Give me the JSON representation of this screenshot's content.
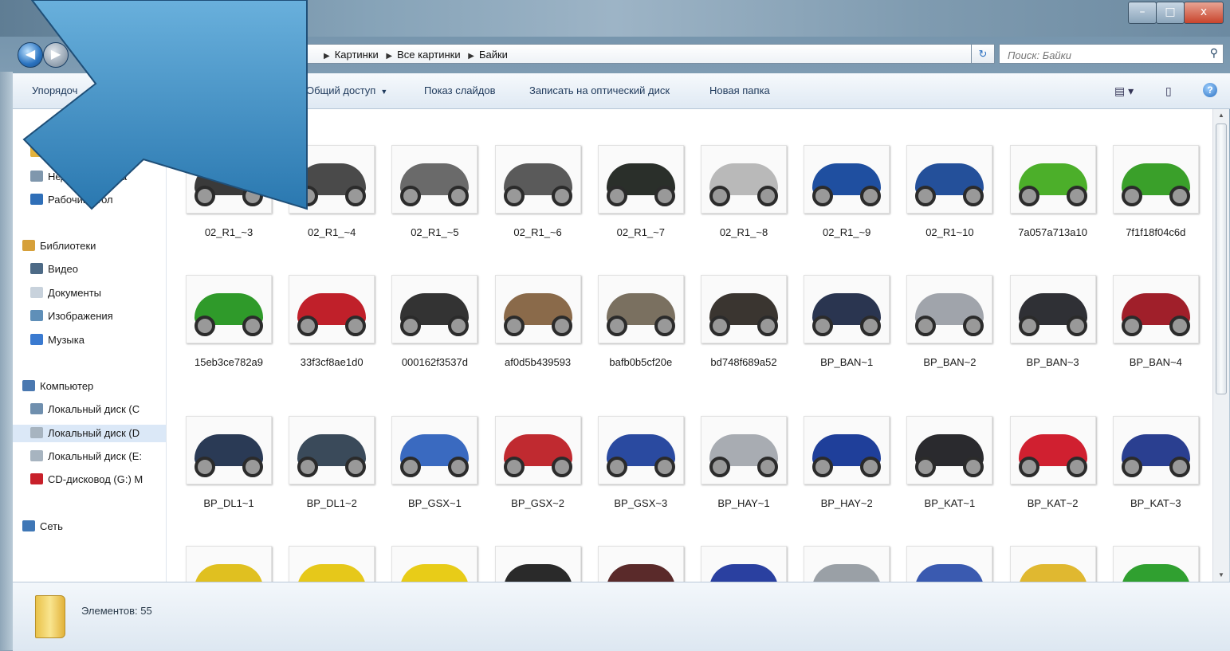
{
  "window": {
    "controls": {
      "minimize": "–",
      "maximize": "□",
      "close": "x"
    }
  },
  "navigation": {
    "back_icon": "back-arrow-icon",
    "forward_icon": "forward-arrow-icon",
    "breadcrumb": [
      "Картинки",
      "Все картинки",
      "Байки"
    ],
    "refresh_glyph": "↻",
    "search_placeholder": "Поиск: Байки"
  },
  "toolbar": {
    "organize": "Упорядоч",
    "share": "Общий доступ",
    "slideshow": "Показ слайдов",
    "burn": "Записать на оптический диск",
    "new_folder": "Новая папка"
  },
  "sidebar": {
    "items": [
      {
        "label": "Загр",
        "type": "item",
        "color": "#e3b23c"
      },
      {
        "label": "Недавние места",
        "type": "item",
        "color": "#7f97ad"
      },
      {
        "label": "Рабочий стол",
        "type": "item",
        "color": "#2f6fb8"
      },
      {
        "label": "Библиотеки",
        "type": "group",
        "color": "#d6a03a"
      },
      {
        "label": "Видео",
        "type": "item",
        "color": "#4d6a86"
      },
      {
        "label": "Документы",
        "type": "item",
        "color": "#c8d2dc"
      },
      {
        "label": "Изображения",
        "type": "item",
        "color": "#5f8fb8"
      },
      {
        "label": "Музыка",
        "type": "item",
        "color": "#3a7ad0"
      },
      {
        "label": "Компьютер",
        "type": "group",
        "color": "#4a78b0"
      },
      {
        "label": "Локальный диск (C",
        "type": "item",
        "color": "#6f8fae"
      },
      {
        "label": "Локальный диск (D",
        "type": "item",
        "color": "#a7b4c0",
        "selected": true
      },
      {
        "label": "Локальный диск (E:",
        "type": "item",
        "color": "#a7b4c0"
      },
      {
        "label": "CD-дисковод (G:) M",
        "type": "item",
        "color": "#c8202a"
      },
      {
        "label": "Сеть",
        "type": "group",
        "color": "#3f77b6"
      }
    ]
  },
  "files": [
    {
      "name": "02_R1_~3",
      "color": "#3a3a3a"
    },
    {
      "name": "02_R1_~4",
      "color": "#4a4a4a"
    },
    {
      "name": "02_R1_~5",
      "color": "#6a6a6a"
    },
    {
      "name": "02_R1_~6",
      "color": "#5a5a5a"
    },
    {
      "name": "02_R1_~7",
      "color": "#2a2f2a"
    },
    {
      "name": "02_R1_~8",
      "color": "#b9b9b9"
    },
    {
      "name": "02_R1_~9",
      "color": "#1f4fa0"
    },
    {
      "name": "02_R1~10",
      "color": "#24509a"
    },
    {
      "name": "7a057a713a10",
      "color": "#4caf2a"
    },
    {
      "name": "7f1f18f04c6d",
      "color": "#3aa02a"
    },
    {
      "name": "15eb3ce782a9",
      "color": "#2f9a2a"
    },
    {
      "name": "33f3cf8ae1d0",
      "color": "#c0202a"
    },
    {
      "name": "000162f3537d",
      "color": "#333333"
    },
    {
      "name": "af0d5b439593",
      "color": "#8a6a4a"
    },
    {
      "name": "bafb0b5cf20e",
      "color": "#7a7060"
    },
    {
      "name": "bd748f689a52",
      "color": "#3a3530"
    },
    {
      "name": "BP_BAN~1",
      "color": "#2a3550"
    },
    {
      "name": "BP_BAN~2",
      "color": "#a0a4ab"
    },
    {
      "name": "BP_BAN~3",
      "color": "#2f3035"
    },
    {
      "name": "BP_BAN~4",
      "color": "#a01f2a"
    },
    {
      "name": "BP_DL1~1",
      "color": "#2a3a55"
    },
    {
      "name": "BP_DL1~2",
      "color": "#3a4a5a"
    },
    {
      "name": "BP_GSX~1",
      "color": "#3a6ac0"
    },
    {
      "name": "BP_GSX~2",
      "color": "#c02a30"
    },
    {
      "name": "BP_GSX~3",
      "color": "#2a4aa0"
    },
    {
      "name": "BP_HAY~1",
      "color": "#a8acb2"
    },
    {
      "name": "BP_HAY~2",
      "color": "#1f3f9a"
    },
    {
      "name": "BP_KAT~1",
      "color": "#2a2a2e"
    },
    {
      "name": "BP_KAT~2",
      "color": "#d02030"
    },
    {
      "name": "BP_KAT~3",
      "color": "#2a3f90"
    },
    {
      "name": "",
      "color": "#e0c020"
    },
    {
      "name": "",
      "color": "#e6c81a"
    },
    {
      "name": "",
      "color": "#e8cc18"
    },
    {
      "name": "",
      "color": "#2a2a2a"
    },
    {
      "name": "",
      "color": "#5a2a2a"
    },
    {
      "name": "",
      "color": "#2a40a0"
    },
    {
      "name": "",
      "color": "#9aa0a6"
    },
    {
      "name": "",
      "color": "#3a5ab0"
    },
    {
      "name": "",
      "color": "#e0b830"
    },
    {
      "name": "",
      "color": "#30a030"
    }
  ],
  "status": {
    "item_count": "Элементов: 55"
  },
  "overlay": {
    "arrow_color": "#2f7fb8",
    "arrow_icon": "large-pointer-arrow-icon"
  }
}
